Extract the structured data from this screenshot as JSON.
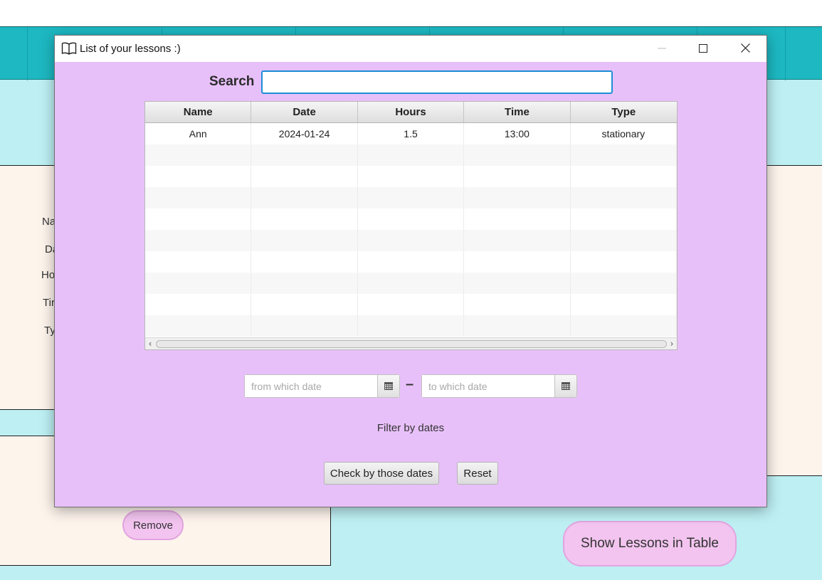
{
  "background_app": {
    "form_labels": [
      "Na",
      "Da",
      "Ho",
      "Tir",
      "Ty"
    ],
    "remove_button": "Remove",
    "show_table_button": "Show Lessons in Table"
  },
  "dialog": {
    "title": "List of your lessons :)",
    "search": {
      "label": "Search",
      "value": "",
      "placeholder": ""
    },
    "table": {
      "columns": [
        "Name",
        "Date",
        "Hours",
        "Time",
        "Type"
      ],
      "rows": [
        [
          "Ann",
          "2024-01-24",
          "1.5",
          "13:00",
          "stationary"
        ]
      ],
      "empty_rows": 9
    },
    "date_filter": {
      "from_placeholder": "from which date",
      "to_placeholder": "to which date",
      "separator": "–",
      "label": "Filter by dates"
    },
    "buttons": {
      "check": "Check by those dates",
      "reset": "Reset"
    },
    "window_controls": [
      "minimize-icon",
      "maximize-icon",
      "close-icon"
    ]
  }
}
